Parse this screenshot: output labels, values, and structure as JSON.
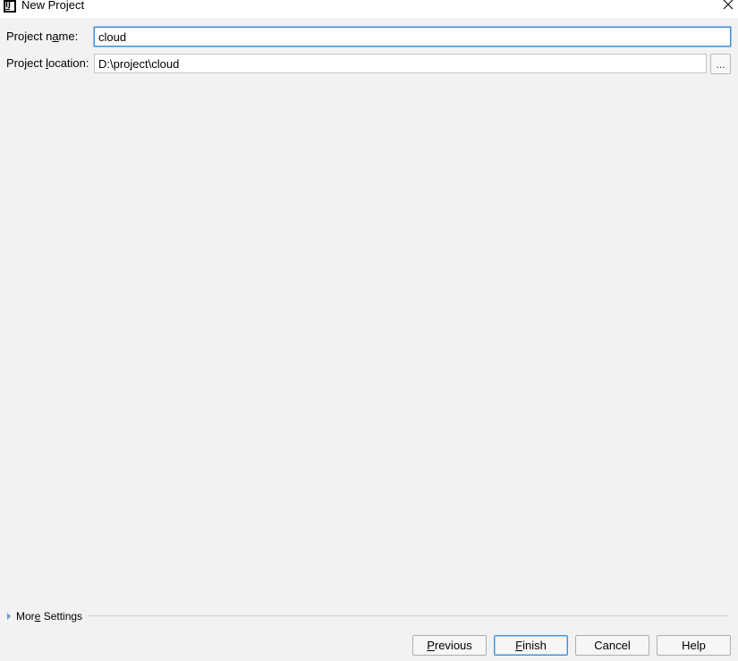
{
  "window": {
    "title": "New Project",
    "app_icon_glyph": "IJ"
  },
  "form": {
    "project_name": {
      "label_prefix": "Project n",
      "label_mnemonic": "a",
      "label_suffix": "me:",
      "value": "cloud"
    },
    "project_location": {
      "label_prefix": "Project ",
      "label_mnemonic": "l",
      "label_suffix": "ocation:",
      "value": "D:\\project\\cloud"
    },
    "browse_label": "..."
  },
  "more_settings": {
    "label_prefix": "Mor",
    "label_mnemonic": "e",
    "label_suffix": " Settings"
  },
  "buttons": {
    "previous": {
      "mnemonic": "P",
      "rest": "revious"
    },
    "finish": {
      "mnemonic": "F",
      "rest": "inish"
    },
    "cancel": {
      "label": "Cancel"
    },
    "help": {
      "label": "Help"
    }
  },
  "colors": {
    "focus_border": "#3d8fd6",
    "expand_triangle": "#6e95c8",
    "background": "#f2f2f2"
  },
  "icons": {
    "app": "intellij-idea-icon",
    "close": "close-icon",
    "expand": "triangle-right-icon"
  }
}
